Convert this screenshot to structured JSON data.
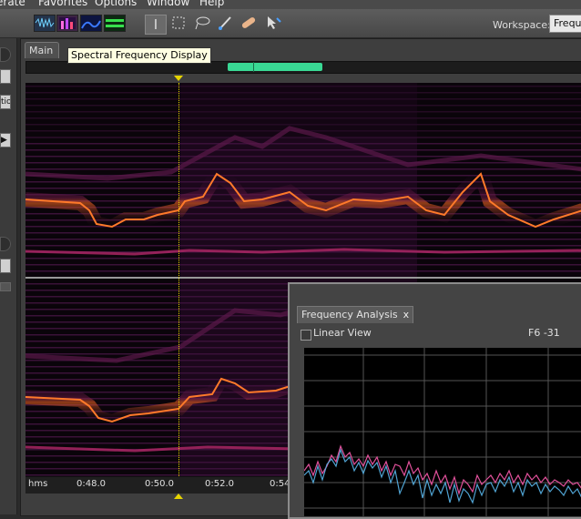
{
  "menu": {
    "items": [
      "erate",
      "Favorites",
      "Options",
      "Window",
      "Help"
    ]
  },
  "toolbar": {
    "workspace_label": "Workspace:",
    "workspace_value": "Frequ"
  },
  "main_tab": {
    "label": "Main"
  },
  "tooltip": {
    "text": "Spectral Frequency Display"
  },
  "left_panel": {
    "label1": "tio",
    "label2": "▶"
  },
  "ruler": {
    "unit": "hms",
    "ticks": [
      "0:48.0",
      "0:50.0",
      "0:52.0",
      "0:54"
    ]
  },
  "freq_panel": {
    "tab_label": "Frequency Analysis",
    "close": "x",
    "linear_view_label": "Linear View",
    "readout": "F6 -31"
  },
  "colors": {
    "overview_thumb": "#39d894",
    "playhead": "#e6d400",
    "series_pink": "#e0509a",
    "series_blue": "#58b4e8"
  }
}
